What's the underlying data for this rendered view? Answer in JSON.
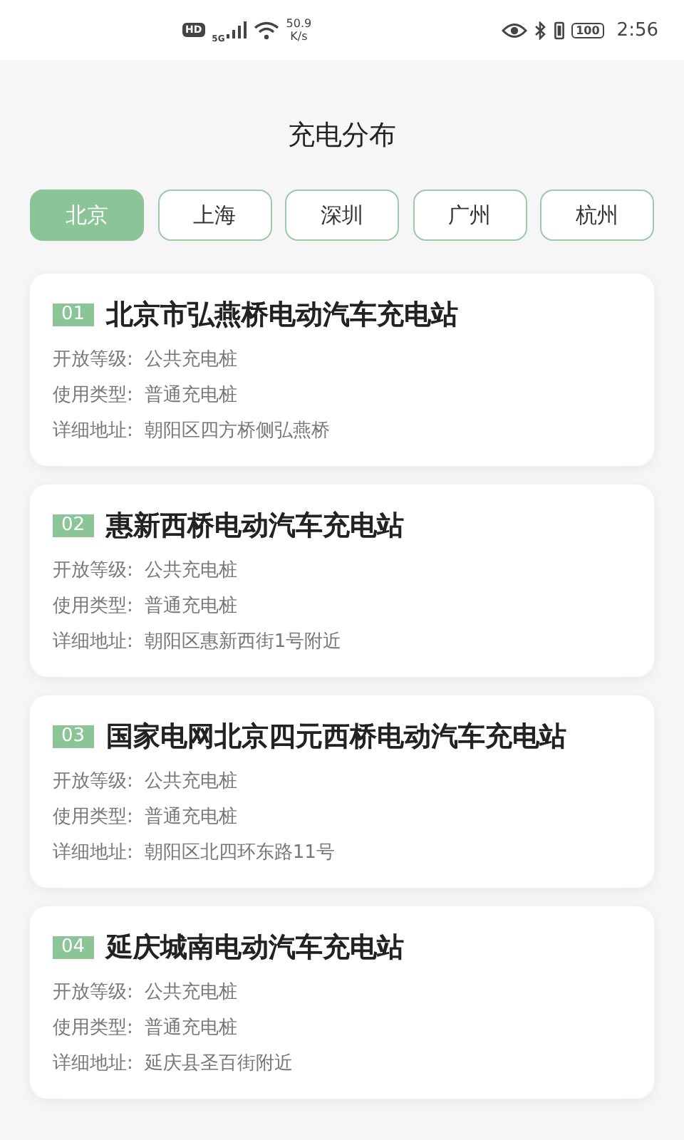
{
  "status_bar": {
    "hd": "HD",
    "network": "5G",
    "speed_value": "50.9",
    "speed_unit": "K/s",
    "battery": "100",
    "time": "2:56"
  },
  "title": "充电分布",
  "tabs": [
    {
      "label": "北京",
      "selected": true
    },
    {
      "label": "上海",
      "selected": false
    },
    {
      "label": "深圳",
      "selected": false
    },
    {
      "label": "广州",
      "selected": false
    },
    {
      "label": "杭州",
      "selected": false
    }
  ],
  "stations": [
    {
      "index": "01",
      "name": "北京市弘燕桥电动汽车充电站",
      "fields": [
        {
          "label": "开放等级:",
          "value": "公共充电桩"
        },
        {
          "label": "使用类型:",
          "value": "普通充电桩"
        },
        {
          "label": "详细地址:",
          "value": "朝阳区四方桥侧弘燕桥"
        }
      ]
    },
    {
      "index": "02",
      "name": "惠新西桥电动汽车充电站",
      "fields": [
        {
          "label": "开放等级:",
          "value": "公共充电桩"
        },
        {
          "label": "使用类型:",
          "value": "普通充电桩"
        },
        {
          "label": "详细地址:",
          "value": "朝阳区惠新西街1号附近"
        }
      ]
    },
    {
      "index": "03",
      "name": "国家电网北京四元西桥电动汽车充电站",
      "fields": [
        {
          "label": "开放等级:",
          "value": "公共充电桩"
        },
        {
          "label": "使用类型:",
          "value": "普通充电桩"
        },
        {
          "label": "详细地址:",
          "value": "朝阳区北四环东路11号"
        }
      ]
    },
    {
      "index": "04",
      "name": "延庆城南电动汽车充电站",
      "fields": [
        {
          "label": "开放等级:",
          "value": "公共充电桩"
        },
        {
          "label": "使用类型:",
          "value": "普通充电桩"
        },
        {
          "label": "详细地址:",
          "value": "延庆县圣百街附近"
        }
      ]
    }
  ]
}
